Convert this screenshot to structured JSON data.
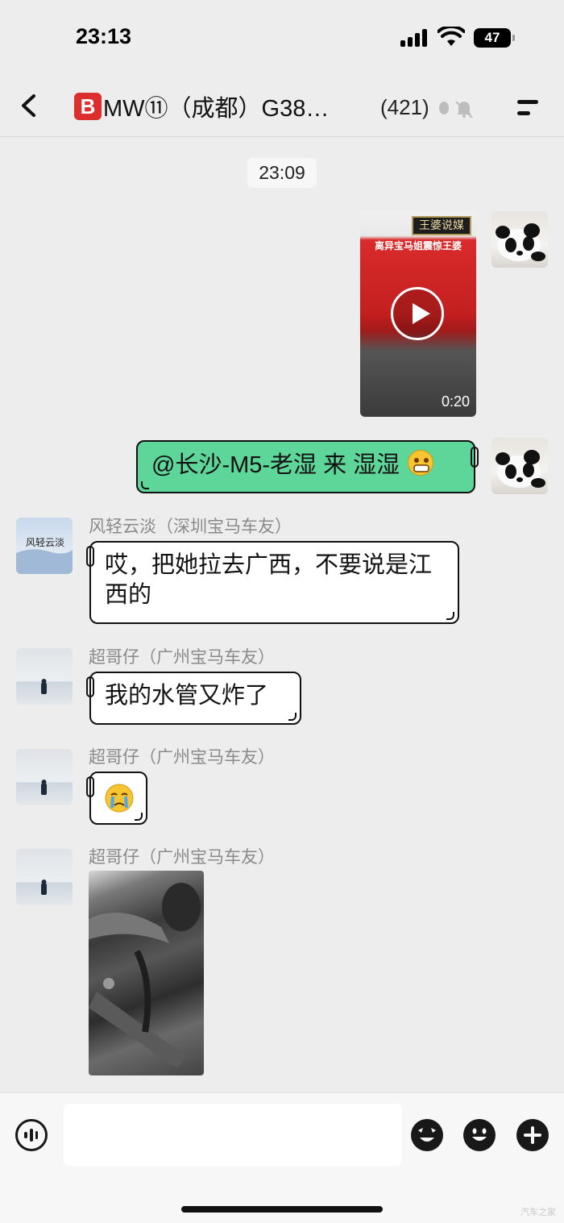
{
  "status_bar": {
    "time": "23:13",
    "battery": "47"
  },
  "header": {
    "badge": "B",
    "title": "MW⑪（成都）G38…",
    "member_count": "(421)"
  },
  "messages": {
    "time_tag": "23:09",
    "video": {
      "sign_text": "王婆说媒",
      "caption": "离异宝马姐震惊王婆",
      "duration": "0:20"
    },
    "sent_text": "@长沙-M5-老湿 来 湿湿",
    "msg1": {
      "sender": "风轻云淡（深圳宝马车友）",
      "text": "哎，把她拉去广西，不要说是江西的",
      "avatar_text": "风轻云淡"
    },
    "msg2": {
      "sender": "超哥仔（广州宝马车友）",
      "text": "我的水管又炸了"
    },
    "msg3": {
      "sender": "超哥仔（广州宝马车友）"
    },
    "msg4": {
      "sender": "超哥仔（广州宝马车友）"
    }
  },
  "input": {
    "value": "",
    "placeholder": ""
  },
  "watermark": "汽车之家",
  "colors": {
    "sent_bubble": "#5ed599",
    "received_bubble": "#ffffff",
    "background": "#ededed",
    "badge": "#dd2e2e"
  },
  "icons": [
    "back-icon",
    "mute-icon",
    "more-icon",
    "play-icon",
    "voice-icon",
    "sticker-icon",
    "emoji-icon",
    "plus-icon"
  ]
}
